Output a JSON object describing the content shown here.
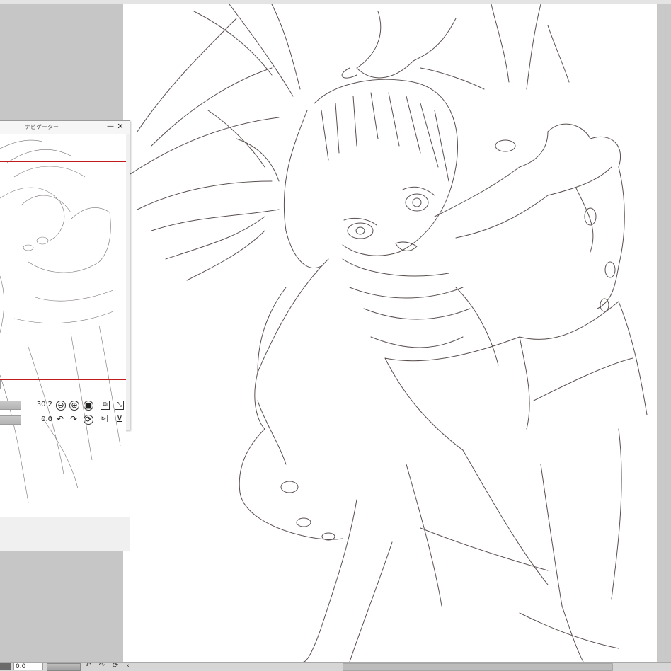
{
  "navigator": {
    "title": "ナビゲーター",
    "minimize_glyph": "—",
    "close_glyph": "✕",
    "zoom_value": "30.2",
    "rotation_value": "0.0",
    "icons": {
      "zoom_out": "⊖",
      "zoom_in": "⊕",
      "zoom_reset": "■",
      "fit_window": "⧉",
      "fit_screen": "⤡",
      "rotate_left": "↶",
      "rotate_right": "↷",
      "rotate_reset": "⟳",
      "flip_horizontal": "⊳|",
      "flip_vertical": "⊻"
    }
  },
  "statusbar": {
    "rotation_value": "0.0",
    "rotate_left": "↶",
    "rotate_right": "↷",
    "rotate_reset": "⟳",
    "scroll_left": "‹"
  },
  "colors": {
    "workspace": "#c6c6c6",
    "paper": "#ffffff",
    "line_art": "#5a4f4f",
    "navigator_frame": "#c21b1b"
  }
}
